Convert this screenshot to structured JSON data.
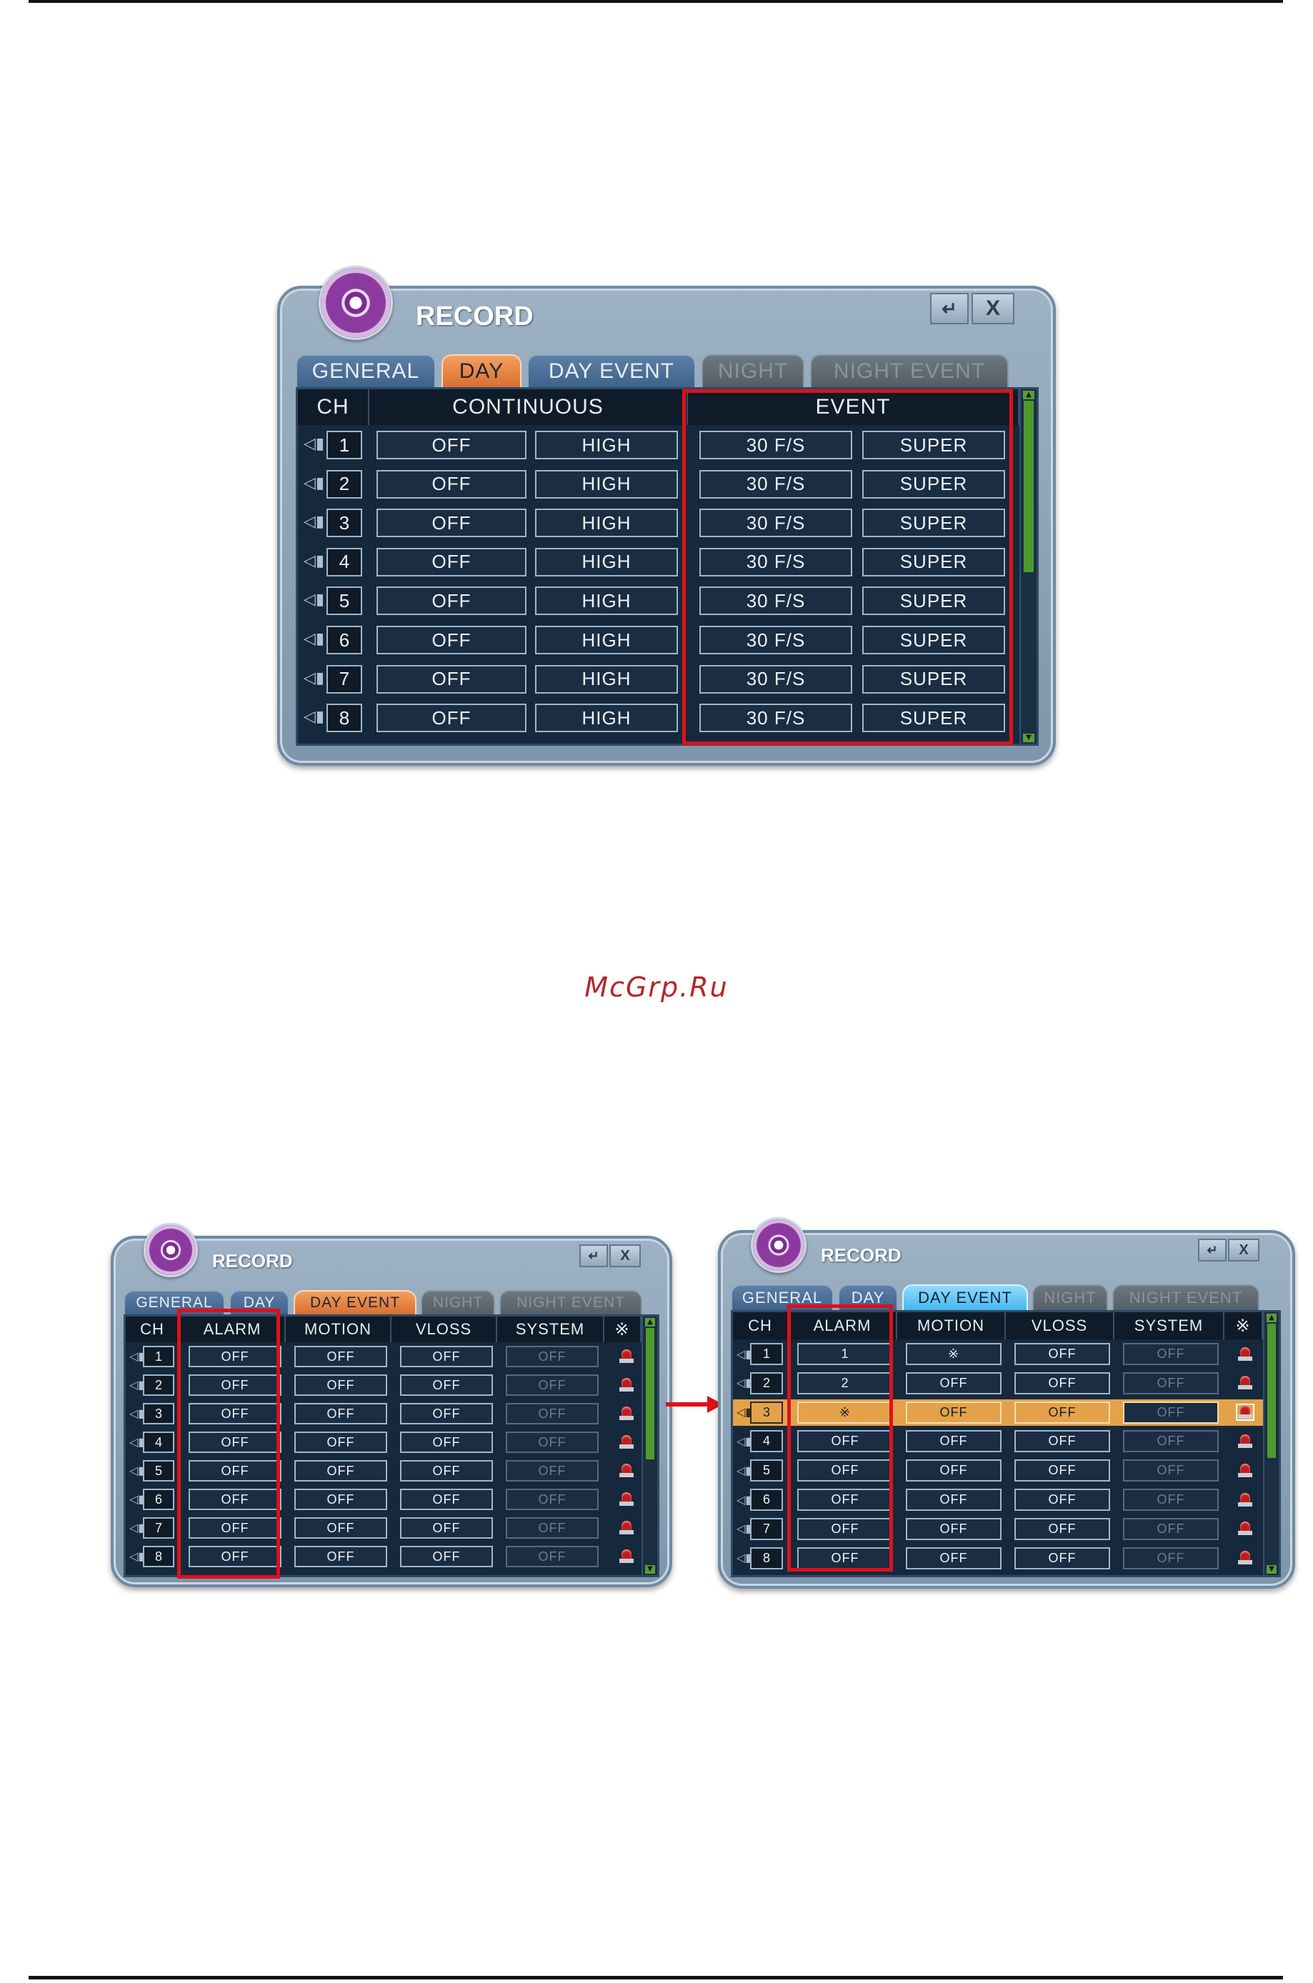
{
  "watermark": "McGrp.Ru",
  "windows": [
    {
      "title": "RECORD",
      "return_label": "↵",
      "close_label": "X",
      "tabs": [
        "GENERAL",
        "DAY",
        "DAY EVENT",
        "NIGHT",
        "NIGHT EVENT"
      ],
      "headers": [
        "CH",
        "CONTINUOUS",
        "EVENT"
      ],
      "rows": [
        {
          "ch": "1",
          "c1": "OFF",
          "c2": "HIGH",
          "e1": "30 F/S",
          "e2": "SUPER"
        },
        {
          "ch": "2",
          "c1": "OFF",
          "c2": "HIGH",
          "e1": "30 F/S",
          "e2": "SUPER"
        },
        {
          "ch": "3",
          "c1": "OFF",
          "c2": "HIGH",
          "e1": "30 F/S",
          "e2": "SUPER"
        },
        {
          "ch": "4",
          "c1": "OFF",
          "c2": "HIGH",
          "e1": "30 F/S",
          "e2": "SUPER"
        },
        {
          "ch": "5",
          "c1": "OFF",
          "c2": "HIGH",
          "e1": "30 F/S",
          "e2": "SUPER"
        },
        {
          "ch": "6",
          "c1": "OFF",
          "c2": "HIGH",
          "e1": "30 F/S",
          "e2": "SUPER"
        },
        {
          "ch": "7",
          "c1": "OFF",
          "c2": "HIGH",
          "e1": "30 F/S",
          "e2": "SUPER"
        },
        {
          "ch": "8",
          "c1": "OFF",
          "c2": "HIGH",
          "e1": "30 F/S",
          "e2": "SUPER"
        }
      ]
    },
    {
      "title": "RECORD",
      "return_label": "↵",
      "close_label": "X",
      "tabs": [
        "GENERAL",
        "DAY",
        "DAY EVENT",
        "NIGHT",
        "NIGHT EVENT"
      ],
      "headers": [
        "CH",
        "ALARM",
        "MOTION",
        "VLOSS",
        "SYSTEM",
        "※"
      ],
      "rows": [
        {
          "ch": "1",
          "alarm": "OFF",
          "motion": "OFF",
          "vloss": "OFF",
          "system": "OFF"
        },
        {
          "ch": "2",
          "alarm": "OFF",
          "motion": "OFF",
          "vloss": "OFF",
          "system": "OFF"
        },
        {
          "ch": "3",
          "alarm": "OFF",
          "motion": "OFF",
          "vloss": "OFF",
          "system": "OFF"
        },
        {
          "ch": "4",
          "alarm": "OFF",
          "motion": "OFF",
          "vloss": "OFF",
          "system": "OFF"
        },
        {
          "ch": "5",
          "alarm": "OFF",
          "motion": "OFF",
          "vloss": "OFF",
          "system": "OFF"
        },
        {
          "ch": "6",
          "alarm": "OFF",
          "motion": "OFF",
          "vloss": "OFF",
          "system": "OFF"
        },
        {
          "ch": "7",
          "alarm": "OFF",
          "motion": "OFF",
          "vloss": "OFF",
          "system": "OFF"
        },
        {
          "ch": "8",
          "alarm": "OFF",
          "motion": "OFF",
          "vloss": "OFF",
          "system": "OFF"
        }
      ]
    },
    {
      "title": "RECORD",
      "return_label": "↵",
      "close_label": "X",
      "tabs": [
        "GENERAL",
        "DAY",
        "DAY EVENT",
        "NIGHT",
        "NIGHT EVENT"
      ],
      "headers": [
        "CH",
        "ALARM",
        "MOTION",
        "VLOSS",
        "SYSTEM",
        "※"
      ],
      "rows": [
        {
          "ch": "1",
          "alarm": "1",
          "motion": "※",
          "vloss": "OFF",
          "system": "OFF"
        },
        {
          "ch": "2",
          "alarm": "2",
          "motion": "OFF",
          "vloss": "OFF",
          "system": "OFF"
        },
        {
          "ch": "3",
          "alarm": "※",
          "motion": "OFF",
          "vloss": "OFF",
          "system": "OFF"
        },
        {
          "ch": "4",
          "alarm": "OFF",
          "motion": "OFF",
          "vloss": "OFF",
          "system": "OFF"
        },
        {
          "ch": "5",
          "alarm": "OFF",
          "motion": "OFF",
          "vloss": "OFF",
          "system": "OFF"
        },
        {
          "ch": "6",
          "alarm": "OFF",
          "motion": "OFF",
          "vloss": "OFF",
          "system": "OFF"
        },
        {
          "ch": "7",
          "alarm": "OFF",
          "motion": "OFF",
          "vloss": "OFF",
          "system": "OFF"
        },
        {
          "ch": "8",
          "alarm": "OFF",
          "motion": "OFF",
          "vloss": "OFF",
          "system": "OFF"
        }
      ]
    }
  ]
}
